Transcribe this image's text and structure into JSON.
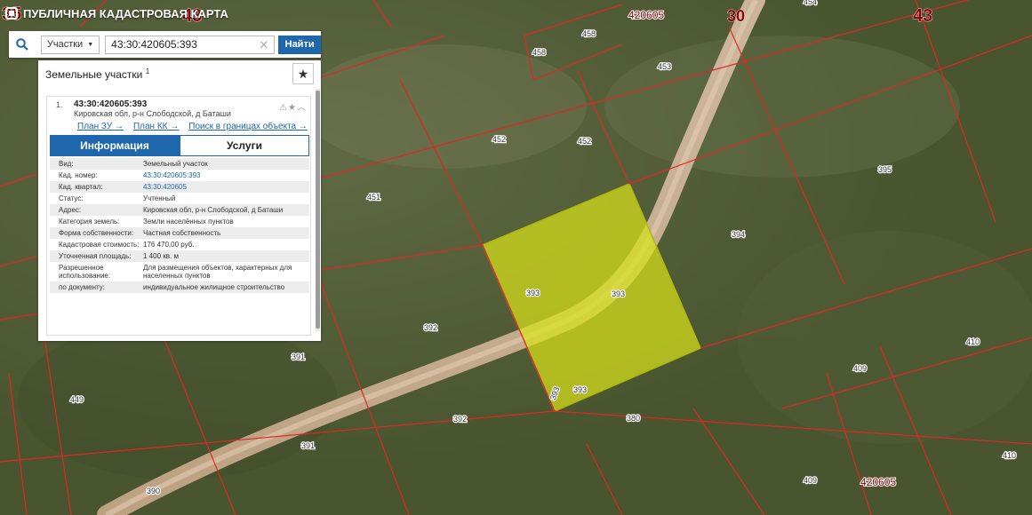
{
  "app": {
    "title": "ПУБЛИЧНАЯ КАДАСТРОВАЯ КАРТА"
  },
  "search": {
    "type_label": "Участки",
    "query": "43:30:420605:393",
    "find_label": "Найти"
  },
  "panel": {
    "title": "Земельные участки",
    "count": "1"
  },
  "result": {
    "index": "1.",
    "cad_number": "43:30:420605:393",
    "address": "Кировская обл, р-н Слободской, д Баташи",
    "links": [
      "План ЗУ →",
      "План КК →",
      "Поиск в границах объекта →"
    ],
    "tabs": [
      "Информация",
      "Услуги"
    ],
    "rows": [
      {
        "k": "Вид:",
        "v": "Земельный участок"
      },
      {
        "k": "Кад. номер:",
        "v": "43:30:420605:393",
        "link": true
      },
      {
        "k": "Кад. квартал:",
        "v": "43:30:420605",
        "link": true
      },
      {
        "k": "Статус:",
        "v": "Учтенный"
      },
      {
        "k": "Адрес:",
        "v": "Кировская обл, р-н Слободской, д Баташи"
      },
      {
        "k": "Категория земель:",
        "v": "Земли населённых пунктов"
      },
      {
        "k": "Форма собственности:",
        "v": "Частная собственность"
      },
      {
        "k": "Кадастровая стоимость:",
        "v": "176 470,00 руб."
      },
      {
        "k": "Уточненная площадь:",
        "v": "1 400 кв. м"
      },
      {
        "k": "Разрешенное использование:",
        "v": "Для размещения объектов, характерных для населенных пунктов"
      },
      {
        "k": "по документу:",
        "v": "индивидуальное жилищное строительство"
      }
    ]
  },
  "map": {
    "big_labels": [
      "35",
      "43",
      "30",
      "43"
    ],
    "quarter_labels": [
      "420605",
      "420605"
    ],
    "parcel_labels": [
      "454",
      "458",
      "458",
      "453",
      "452",
      "452",
      "451",
      "395",
      "394",
      "393",
      "393",
      "393",
      "393",
      "392",
      "392",
      "391",
      "391",
      "390",
      "449",
      "380",
      "409",
      "409",
      "410",
      "410"
    ],
    "colors": {
      "boundary": "#e0262b",
      "selected_fill": "#d8e21a",
      "label_text": "#8a0000"
    }
  }
}
